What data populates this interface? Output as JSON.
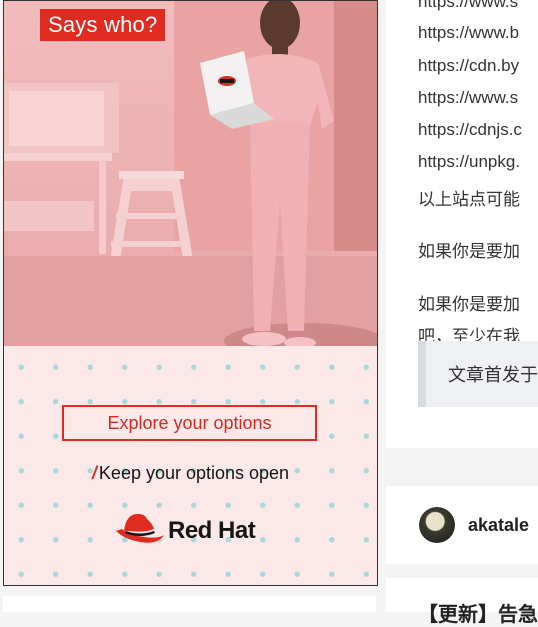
{
  "ad": {
    "badge": "Says who?",
    "button_label": "Explore your options",
    "tagline_slash": "/",
    "tagline": "Keep your options open",
    "brand": "Red Hat",
    "colors": {
      "brand_red": "#e02b20",
      "pink_bg": "#fbe9e9",
      "dot": "#a9d7da"
    }
  },
  "article": {
    "links": [
      "https://www.s",
      "https://www.b",
      "https://cdn.by",
      "https://www.s",
      "https://cdnjs.c",
      "https://unpkg."
    ],
    "note": "以上站点可能",
    "para1": "如果你是要加",
    "para2_line1": "如果你是要加",
    "para2_line2": "吧，至少在我",
    "quote": "文章首发于"
  },
  "author": {
    "name": "akatale"
  },
  "next_post": {
    "title": "【更新】告急"
  }
}
